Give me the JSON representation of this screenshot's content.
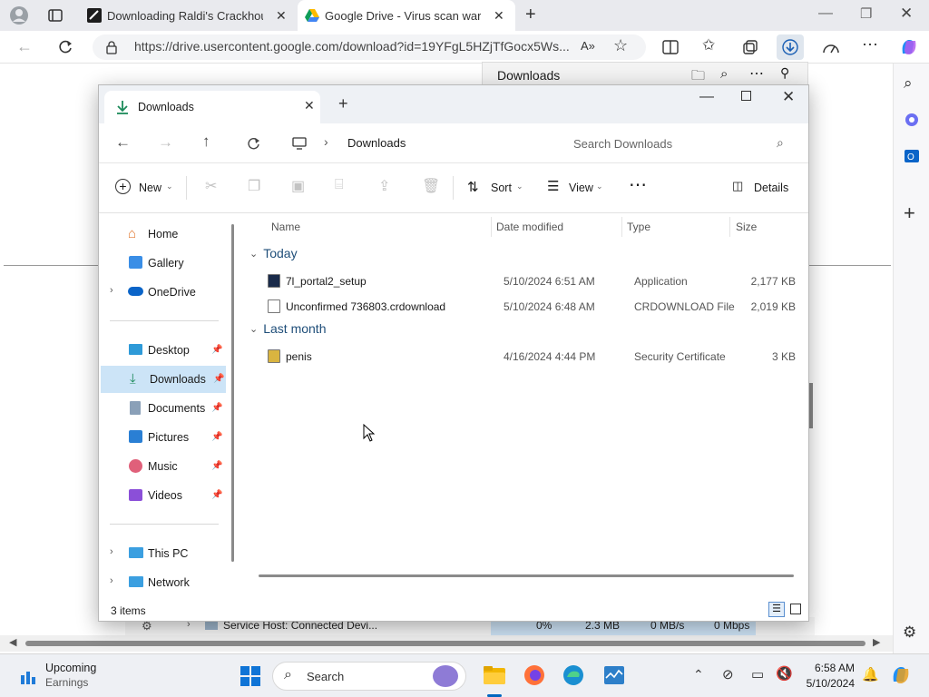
{
  "browser": {
    "tabs": [
      {
        "label": "Downloading Raldi's Crackhouse"
      },
      {
        "label": "Google Drive - Virus scan warning"
      }
    ],
    "url": "https://drive.usercontent.google.com/download?id=19YFgL5HZjTfGocx5Ws...",
    "downloads_flyout_title": "Downloads"
  },
  "explorer": {
    "tab_label": "Downloads",
    "breadcrumb": "Downloads",
    "search_placeholder": "Search Downloads",
    "toolbar": {
      "new_label": "New",
      "sort_label": "Sort",
      "view_label": "View",
      "details_label": "Details"
    },
    "nav": {
      "top": [
        {
          "label": "Home"
        },
        {
          "label": "Gallery"
        },
        {
          "label": "OneDrive"
        }
      ],
      "pinned": [
        {
          "label": "Desktop"
        },
        {
          "label": "Downloads"
        },
        {
          "label": "Documents"
        },
        {
          "label": "Pictures"
        },
        {
          "label": "Music"
        },
        {
          "label": "Videos"
        }
      ],
      "bottom": [
        {
          "label": "This PC"
        },
        {
          "label": "Network"
        }
      ]
    },
    "columns": {
      "name": "Name",
      "date": "Date modified",
      "type": "Type",
      "size": "Size"
    },
    "groups": [
      {
        "label": "Today",
        "files": [
          {
            "name": "7l_portal2_setup",
            "date": "5/10/2024 6:51 AM",
            "type": "Application",
            "size": "2,177 KB"
          },
          {
            "name": "Unconfirmed 736803.crdownload",
            "date": "5/10/2024 6:48 AM",
            "type": "CRDOWNLOAD File",
            "size": "2,019 KB"
          }
        ]
      },
      {
        "label": "Last month",
        "files": [
          {
            "name": "penis",
            "date": "4/16/2024 4:44 PM",
            "type": "Security Certificate",
            "size": "3 KB"
          }
        ]
      }
    ],
    "status_items": "3 items"
  },
  "background_row": {
    "name": "Service Host: Connected Devi...",
    "cpu": "0%",
    "mem": "2.3 MB",
    "disk": "0 MB/s",
    "net": "0 Mbps"
  },
  "taskbar": {
    "widget_title": "Upcoming",
    "widget_sub": "Earnings",
    "search_placeholder": "Search",
    "time": "6:58 AM",
    "date": "5/10/2024"
  },
  "colors": {
    "accent": "#0067c0",
    "selection": "#cce4f7",
    "group_heading": "#1f4e79"
  }
}
